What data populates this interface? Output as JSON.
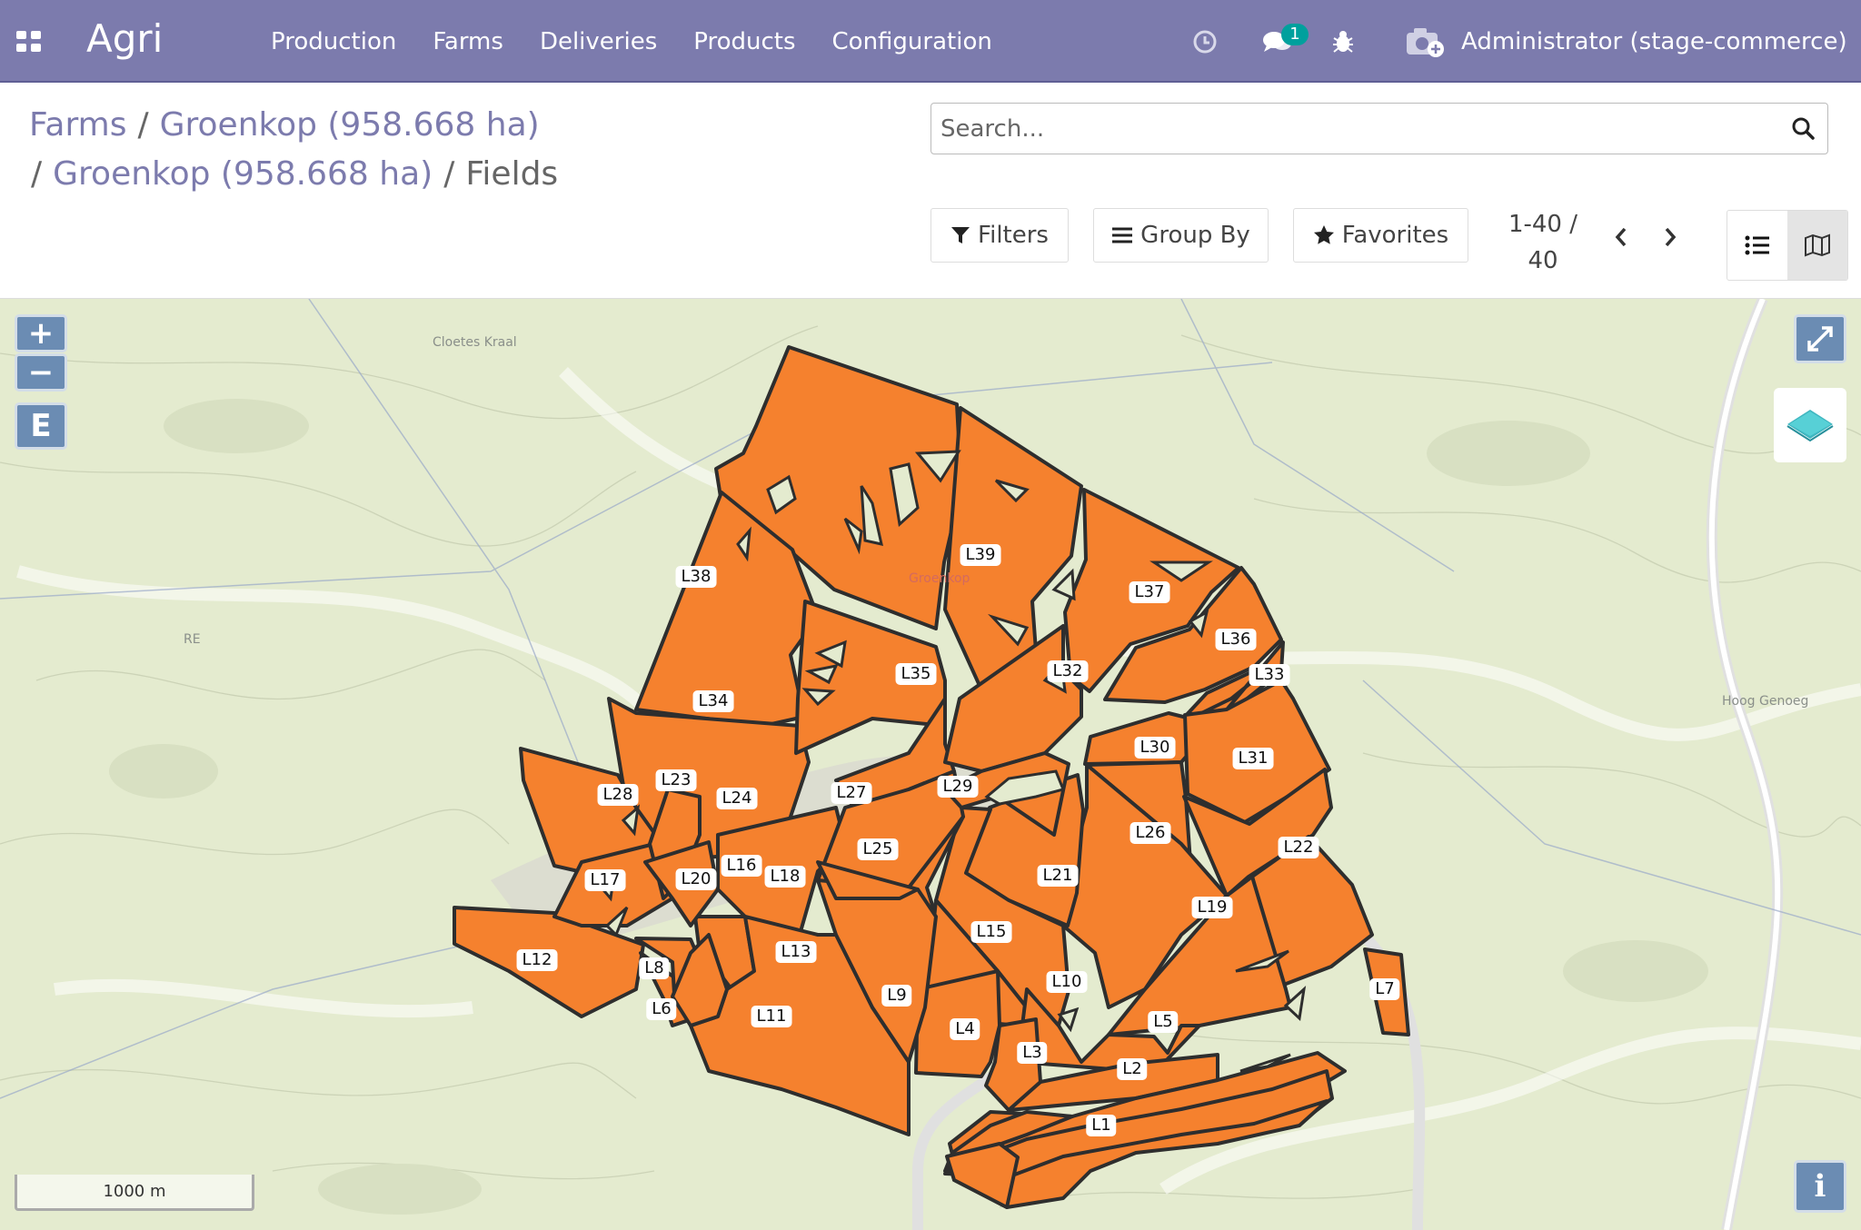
{
  "app": {
    "name": "Agri"
  },
  "menu": [
    "Production",
    "Farms",
    "Deliveries",
    "Products",
    "Configuration"
  ],
  "systray": {
    "messages_count": "1",
    "user": "Administrator (stage-commerce)"
  },
  "breadcrumb": {
    "items": [
      "Farms",
      "Groenkop (958.668 ha)",
      "Groenkop (958.668 ha)"
    ],
    "current": "Fields",
    "separator": "/"
  },
  "search": {
    "placeholder": "Search..."
  },
  "toolbar": {
    "filters": "Filters",
    "group_by": "Group By",
    "favorites": "Favorites"
  },
  "pager": {
    "range": "1-40 /",
    "total": "40"
  },
  "map": {
    "field_color": "#f5812e",
    "scale_label": "1000 m",
    "control_e": "E",
    "info": "i",
    "place_labels": [
      "Cloetes Kraal",
      "Hoog Genoeg",
      "RE",
      "RE",
      "Groenkop"
    ],
    "fields": [
      "L1",
      "L2",
      "L3",
      "L4",
      "L5",
      "L6",
      "L7",
      "L8",
      "L9",
      "L10",
      "L11",
      "L12",
      "L13",
      "L15",
      "L16",
      "L17",
      "L18",
      "L19",
      "L20",
      "L21",
      "L22",
      "L23",
      "L24",
      "L25",
      "L26",
      "L27",
      "L28",
      "L29",
      "L30",
      "L31",
      "L32",
      "L33",
      "L34",
      "L35",
      "L36",
      "L37",
      "L38",
      "L39"
    ]
  }
}
